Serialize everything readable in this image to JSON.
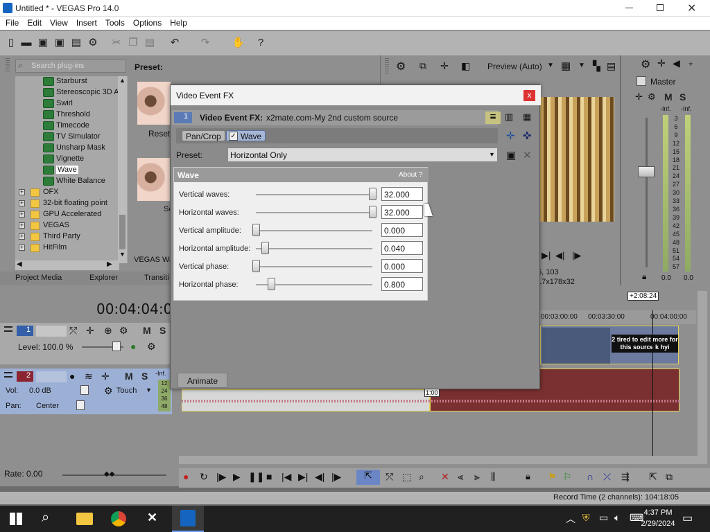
{
  "window": {
    "title": "Untitled * - VEGAS Pro 14.0"
  },
  "menu": [
    "File",
    "Edit",
    "View",
    "Insert",
    "Tools",
    "Options",
    "Help"
  ],
  "plugin_browser": {
    "search_placeholder": "Search plug-ins",
    "preset_label": "Preset:",
    "reset_label": "Reset",
    "items": [
      {
        "label": "Starburst",
        "type": "fx"
      },
      {
        "label": "Stereoscopic 3D A",
        "type": "fx"
      },
      {
        "label": "Swirl",
        "type": "fx"
      },
      {
        "label": "Threshold",
        "type": "fx"
      },
      {
        "label": "Timecode",
        "type": "fx"
      },
      {
        "label": "TV Simulator",
        "type": "fx"
      },
      {
        "label": "Unsharp Mask",
        "type": "fx"
      },
      {
        "label": "Vignette",
        "type": "fx"
      },
      {
        "label": "Wave",
        "type": "fx",
        "selected": true
      },
      {
        "label": "White Balance",
        "type": "fx"
      },
      {
        "label": "OFX",
        "type": "folder"
      },
      {
        "label": "32-bit floating point",
        "type": "folder"
      },
      {
        "label": "GPU Accelerated",
        "type": "folder"
      },
      {
        "label": "VEGAS",
        "type": "folder"
      },
      {
        "label": "Third Party",
        "type": "folder"
      },
      {
        "label": "HitFilm",
        "type": "folder"
      }
    ],
    "partial_label": "VEGAS Wav",
    "partial_label2": "Sc",
    "tabs": [
      "Project Media",
      "Explorer",
      "Transiti"
    ]
  },
  "preview": {
    "mode": "Preview (Auto)",
    "frame_info": "5, 103",
    "res_info": "17x178x32"
  },
  "mixer": {
    "title": "Master",
    "db_labels": [
      "-Inf.",
      "-Inf."
    ],
    "scale": [
      "3",
      "6",
      "9",
      "12",
      "15",
      "18",
      "21",
      "24",
      "27",
      "30",
      "33",
      "36",
      "39",
      "42",
      "45",
      "48",
      "51",
      "54",
      "57"
    ],
    "bottom": [
      "0.0",
      "0.0"
    ]
  },
  "dialog": {
    "title": "Video Event FX",
    "fx_header_label": "Video Event FX:",
    "fx_header_value": "x2mate.com-My 2nd custom source",
    "chain": [
      {
        "label": "Pan/Crop"
      },
      {
        "label": "Wave"
      }
    ],
    "preset_label": "Preset:",
    "preset_value": "Horizontal Only",
    "panel_title": "Wave",
    "about_label": "About",
    "params": [
      {
        "label": "Vertical waves:",
        "value": "32.000",
        "level": 1.0
      },
      {
        "label": "Horizontal waves:",
        "value": "32.000",
        "level": 1.0
      },
      {
        "label": "Vertical amplitude:",
        "value": "0.000",
        "level": 0.0
      },
      {
        "label": "Horizontal amplitude:",
        "value": "0.040",
        "level": 0.08
      },
      {
        "label": "Vertical phase:",
        "value": "0.000",
        "level": 0.0
      },
      {
        "label": "Horizontal phase:",
        "value": "0.800",
        "level": 0.13
      }
    ],
    "animate_label": "Animate"
  },
  "timeline": {
    "timecode": "00:04:04:03",
    "track1": {
      "num": "1",
      "level": "Level: 100.0 %"
    },
    "track2": {
      "num": "2",
      "vol": "Vol:",
      "vol_val": "0.0 dB",
      "pan": "Pan:",
      "pan_val": "Center",
      "touch": "Touch",
      "inf": "-Inf.",
      "meter": [
        "12",
        "24",
        "36",
        "48"
      ]
    },
    "ruler": [
      "00:03:00:00",
      "00:03:30:00",
      "00:04:00:00"
    ],
    "marker": "+2:08:24",
    "clip_marker": "1:00",
    "overlay_text": "2 tired to edit more for this source k hyi"
  },
  "rate": "Rate: 0.00",
  "status": {
    "record_time": "Record Time (2 channels): 104:18:05"
  },
  "taskbar": {
    "time": "4:37 PM",
    "date": "2/29/2024"
  },
  "colors": {
    "accent": "#1e88e5",
    "dialog_close": "#dd3333",
    "clip_red": "#7a3030",
    "overlay_text": "#ffffff"
  }
}
